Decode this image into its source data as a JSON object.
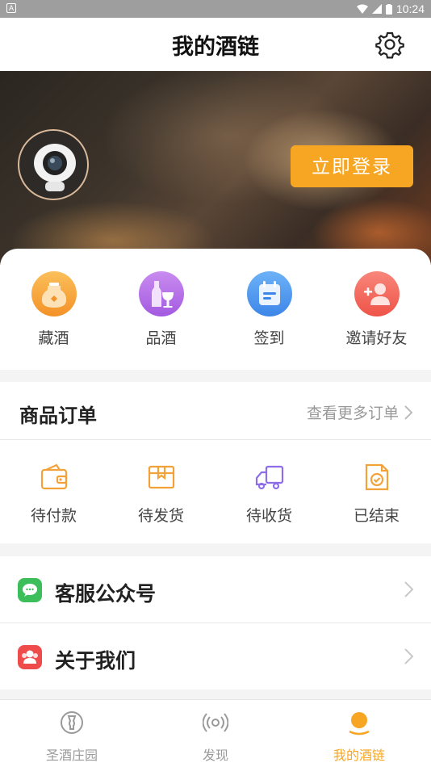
{
  "status_bar": {
    "time": "10:24",
    "left_badge": "A"
  },
  "header": {
    "title": "我的酒链"
  },
  "banner": {
    "login_label": "立即登录"
  },
  "quick_actions": [
    {
      "label": "藏酒",
      "icon": "jar-icon",
      "color": "#f7a33b"
    },
    {
      "label": "品酒",
      "icon": "wine-icon",
      "color": "#b46ee8"
    },
    {
      "label": "签到",
      "icon": "calendar-icon",
      "color": "#4a9af0"
    },
    {
      "label": "邀请好友",
      "icon": "add-friend-icon",
      "color": "#f2645a"
    }
  ],
  "orders": {
    "title": "商品订单",
    "more_label": "查看更多订单",
    "items": [
      {
        "label": "待付款",
        "icon": "wallet-icon"
      },
      {
        "label": "待发货",
        "icon": "package-icon"
      },
      {
        "label": "待收货",
        "icon": "truck-icon"
      },
      {
        "label": "已结束",
        "icon": "done-doc-icon"
      }
    ]
  },
  "menu": [
    {
      "label": "客服公众号",
      "icon": "chat-icon",
      "color": "#3cbf5a"
    },
    {
      "label": "关于我们",
      "icon": "team-icon",
      "color": "#ef4b4b"
    }
  ],
  "tabs": [
    {
      "label": "圣酒庄园",
      "icon": "estate-icon",
      "active": false
    },
    {
      "label": "发现",
      "icon": "discover-icon",
      "active": false
    },
    {
      "label": "我的酒链",
      "icon": "profile-icon",
      "active": true
    }
  ],
  "colors": {
    "accent": "#f6a623",
    "background": "#f4f4f4"
  }
}
